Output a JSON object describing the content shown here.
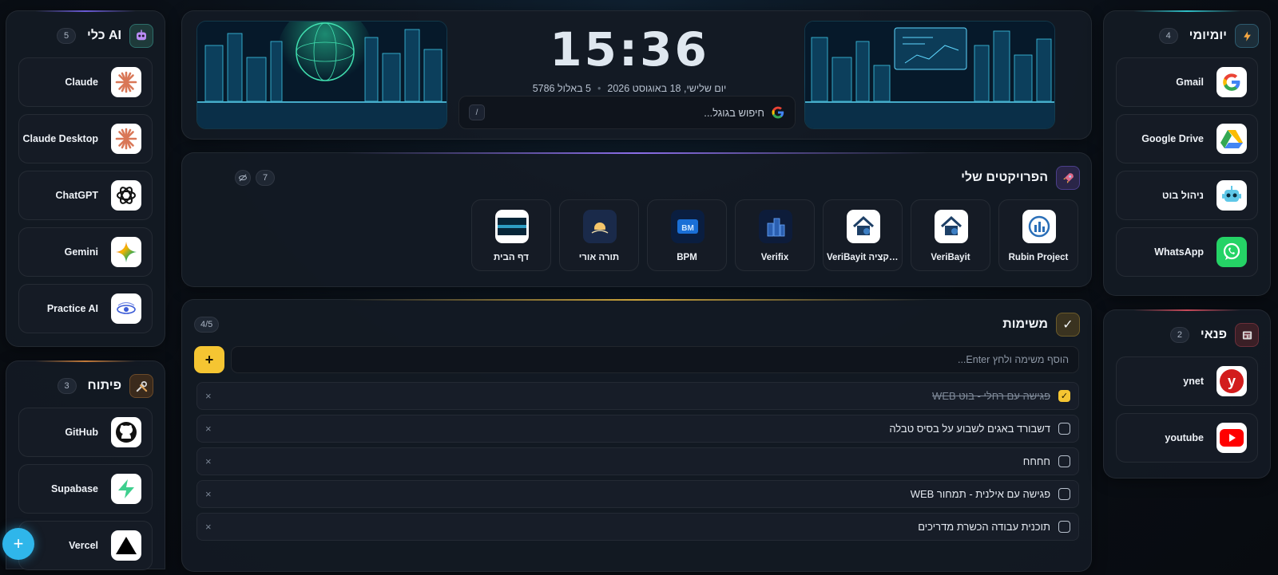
{
  "left": {
    "ai": {
      "title": "כלי AI",
      "count": "5",
      "items": [
        {
          "label": "Claude",
          "icon": "claude-icon"
        },
        {
          "label": "Claude Desktop",
          "icon": "claude-icon"
        },
        {
          "label": "ChatGPT",
          "icon": "chatgpt-icon"
        },
        {
          "label": "Gemini",
          "icon": "gemini-icon"
        },
        {
          "label": "Practice AI",
          "icon": "eye-icon"
        }
      ]
    },
    "dev": {
      "title": "פיתוח",
      "count": "3",
      "items": [
        {
          "label": "GitHub",
          "icon": "github-icon"
        },
        {
          "label": "Supabase",
          "icon": "supabase-icon"
        },
        {
          "label": "Vercel",
          "icon": "vercel-icon"
        }
      ]
    }
  },
  "right": {
    "daily": {
      "title": "יומיומי",
      "count": "4",
      "items": [
        {
          "label": "Gmail",
          "icon": "google-icon"
        },
        {
          "label": "Google Drive",
          "icon": "google-drive-icon"
        },
        {
          "label": "ניהול בוט",
          "icon": "robot-icon"
        },
        {
          "label": "WhatsApp",
          "icon": "whatsapp-icon"
        }
      ]
    },
    "leisure": {
      "title": "פנאי",
      "count": "2",
      "items": [
        {
          "label": "ynet",
          "icon": "ynet-icon"
        },
        {
          "label": "youtube",
          "icon": "youtube-icon"
        }
      ]
    }
  },
  "hero": {
    "time": "15:36",
    "date_greg": "יום שלישי, 18 באוגוסט 2026",
    "date_heb": "5 באלול 5786",
    "search_placeholder": "חיפוש בגוגל...",
    "search_shortcut": "/"
  },
  "projects": {
    "title": "הפרויקטים שלי",
    "count": "7",
    "items": [
      {
        "label": "Rubin Project"
      },
      {
        "label": "VeriBayit"
      },
      {
        "label": "VeriBayit אפליקציה"
      },
      {
        "label": "Verifix"
      },
      {
        "label": "BPM"
      },
      {
        "label": "תורה אורי"
      },
      {
        "label": "דף הבית"
      }
    ]
  },
  "tasks": {
    "title": "משימות",
    "progress": "4/5",
    "input_placeholder": "הוסף משימה ולחץ Enter...",
    "add_label": "+",
    "items": [
      {
        "text": "פגישה עם רחלי - בוט WEB",
        "done": true
      },
      {
        "text": "דשבורד באגים לשבוע על בסיס טבלה",
        "done": false
      },
      {
        "text": "חחחח",
        "done": false
      },
      {
        "text": "פגישה עם אילנית - תמחור WEB",
        "done": false
      },
      {
        "text": "תוכנית עבודה הכשרת מדריכים",
        "done": false
      }
    ],
    "delete_glyph": "×",
    "check_glyph": "✓"
  },
  "fab_label": "+",
  "colors": {
    "accent": "#f5c532",
    "fab": "#2fb6ea"
  }
}
